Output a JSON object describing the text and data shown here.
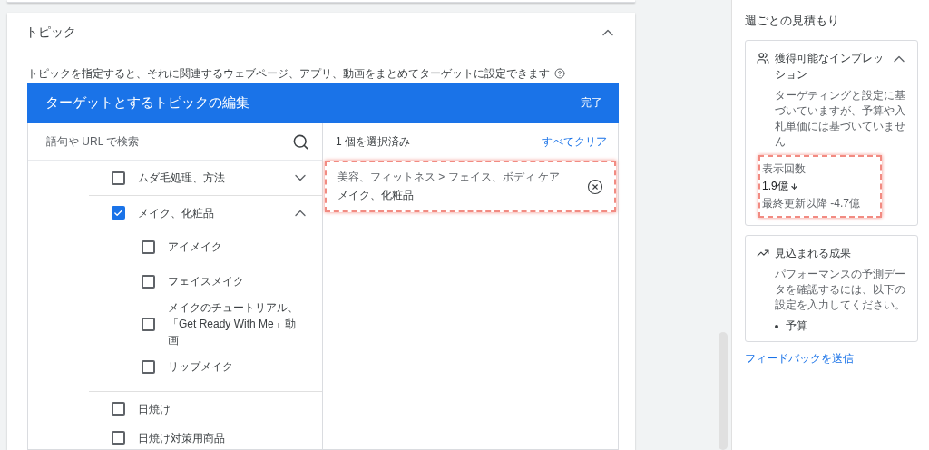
{
  "topic_card": {
    "title": "トピック",
    "expanded": true,
    "description": "トピックを指定すると、それに関連するウェブページ、アプリ、動画をまとめてターゲットに設定できます",
    "editor": {
      "title": "ターゲットとするトピックの編集",
      "done": "完了",
      "search": {
        "placeholder": "語句や URL で検索"
      },
      "tree": [
        {
          "label": "ムダ毛処理、方法",
          "checked": false,
          "expanded": false
        },
        {
          "label": "メイク、化粧品",
          "checked": true,
          "expanded": true,
          "children": [
            {
              "label": "アイメイク",
              "checked": false
            },
            {
              "label": "フェイスメイク",
              "checked": false
            },
            {
              "label": "メイクのチュートリアル、「Get Ready With Me」動画",
              "checked": false
            },
            {
              "label": "リップメイク",
              "checked": false
            }
          ]
        },
        {
          "label": "日焼け",
          "checked": false
        },
        {
          "label": "日焼け対策用商品",
          "checked": false
        }
      ],
      "selected_count": "1 個を選択済み",
      "clear_all": "すべてクリア",
      "selected_items": [
        {
          "path": "美容、フィットネス > フェイス、ボディ ケア",
          "label": "メイク、化粧品",
          "highlighted": true
        }
      ]
    }
  },
  "sidebar": {
    "title": "週ごとの見積もり",
    "impressions": {
      "title": "獲得可能なインプレッション",
      "expanded": true,
      "note": "ターゲティングと設定に基づいていますが、予算や入札単価には基づいていません",
      "stat_label": "表示回数",
      "stat_value": "1.9億",
      "stat_change": "最終更新以降 -4.7億",
      "highlighted": true
    },
    "results": {
      "title": "見込まれる成果",
      "note": "パフォーマンスの予測データを確認するには、以下の設定を入力してください。",
      "items": [
        "予算"
      ]
    },
    "feedback": "フィードバックを送信"
  }
}
